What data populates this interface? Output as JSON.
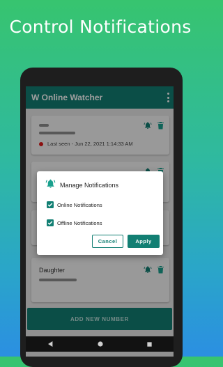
{
  "promo": {
    "title": "Control Notifications"
  },
  "app": {
    "title": "W Online Watcher"
  },
  "contacts": [
    {
      "name": "",
      "last_seen": "Last seen - Jun 22, 2021 1:14:33 AM"
    },
    {
      "name": ""
    },
    {
      "name": ""
    },
    {
      "name": "Daughter"
    }
  ],
  "footer": {
    "add_button": "ADD NEW NUMBER"
  },
  "dialog": {
    "title": "Manage Notifications",
    "options": [
      {
        "label": "Online Notifications",
        "checked": true
      },
      {
        "label": "Offline Notifications",
        "checked": true
      }
    ],
    "cancel": "Cancel",
    "apply": "Apply"
  },
  "colors": {
    "primary": "#127f73",
    "accent": "#1aa08e",
    "offline": "#e01b1b",
    "background_top": "#37c46f",
    "background_bottom": "#2b8fe2"
  },
  "icons": {
    "notification": "bell-ring-icon",
    "delete": "trash-icon",
    "menu": "more-vert-icon"
  }
}
